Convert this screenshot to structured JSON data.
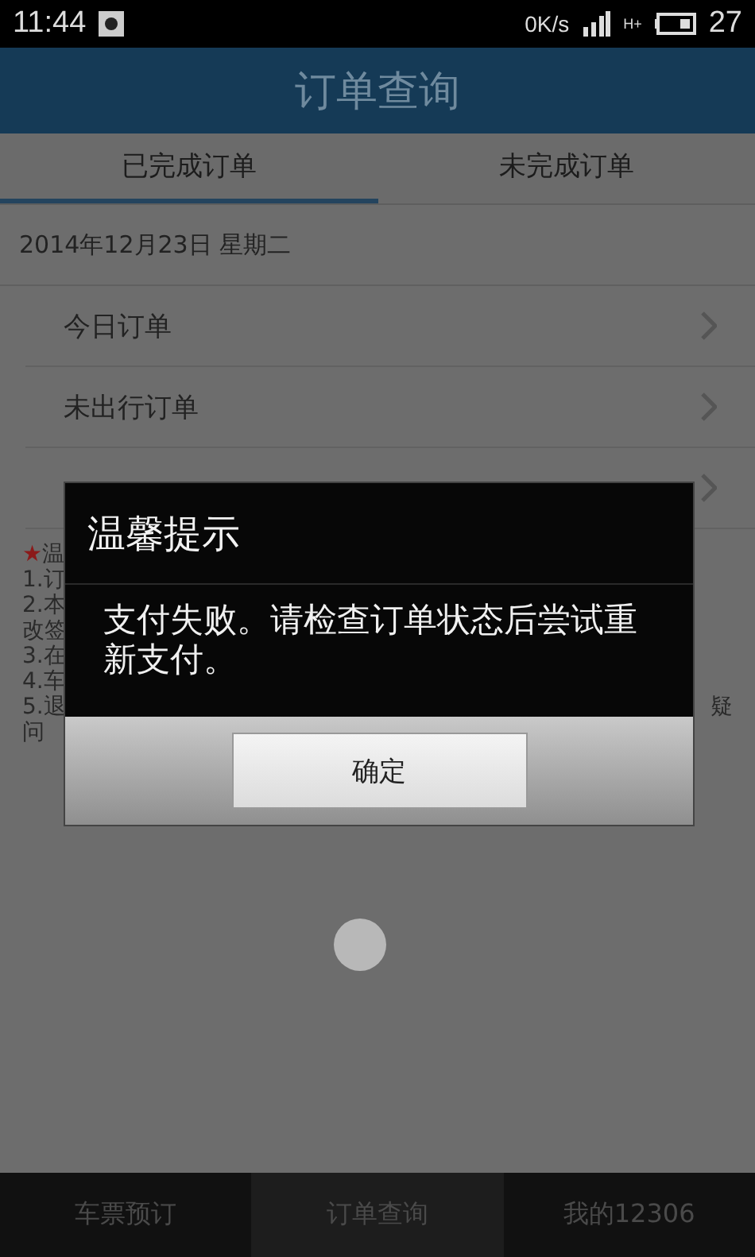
{
  "status_bar": {
    "time": "11:44",
    "speed": "0K/s",
    "network": "H+",
    "battery": "27"
  },
  "header": {
    "title": "订单查询"
  },
  "tabs": [
    {
      "label": "已完成订单",
      "selected": true
    },
    {
      "label": "未完成订单",
      "selected": false
    }
  ],
  "date": "2014年12月23日 星期二",
  "menu": [
    {
      "label": "今日订单"
    },
    {
      "label": "未出行订单"
    }
  ],
  "notice": {
    "lines": [
      {
        "left": "★温"
      },
      {
        "left": "1.订"
      },
      {
        "left": "2.本"
      },
      {
        "left": "改签"
      },
      {
        "left": "3.在"
      },
      {
        "left": "4.车"
      },
      {
        "left": "5.退",
        "right": "疑"
      },
      {
        "left": "问"
      }
    ]
  },
  "dialog": {
    "title": "温馨提示",
    "message": "支付失败。请检查订单状态后尝试重新支付。",
    "button": "确定"
  },
  "bottom_nav": [
    {
      "label": "车票预订",
      "selected": false
    },
    {
      "label": "订单查询",
      "selected": true
    },
    {
      "label": "我的12306",
      "selected": false
    }
  ]
}
